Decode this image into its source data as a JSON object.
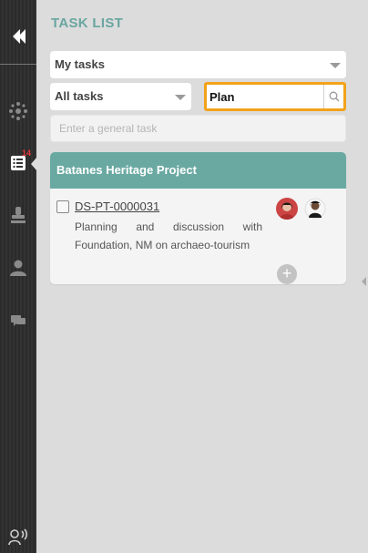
{
  "sidebar": {
    "badge_count": "14",
    "items": [
      {
        "icon": "back-arrow-icon"
      },
      {
        "icon": "network-icon"
      },
      {
        "icon": "task-list-icon"
      },
      {
        "icon": "stamp-icon"
      },
      {
        "icon": "user-icon"
      },
      {
        "icon": "chat-icon"
      },
      {
        "icon": "voice-user-icon"
      }
    ]
  },
  "header": {
    "title": "TASK LIST"
  },
  "filters": {
    "scope_select": "My tasks",
    "status_select": "All tasks",
    "search_value": "Plan",
    "general_task_placeholder": "Enter a general task"
  },
  "project": {
    "name": "Batanes Heritage Project",
    "tasks": [
      {
        "id": "DS-PT-0000031",
        "description": "Planning and discussion with Foundation, NM on archaeo-tourism",
        "add_label": "+"
      }
    ]
  },
  "colors": {
    "accent": "#6aa9a2",
    "title": "#6aa6a0",
    "search_border": "#f2a21a",
    "badge": "#e23a3a",
    "rail": "#2b2b2b"
  }
}
